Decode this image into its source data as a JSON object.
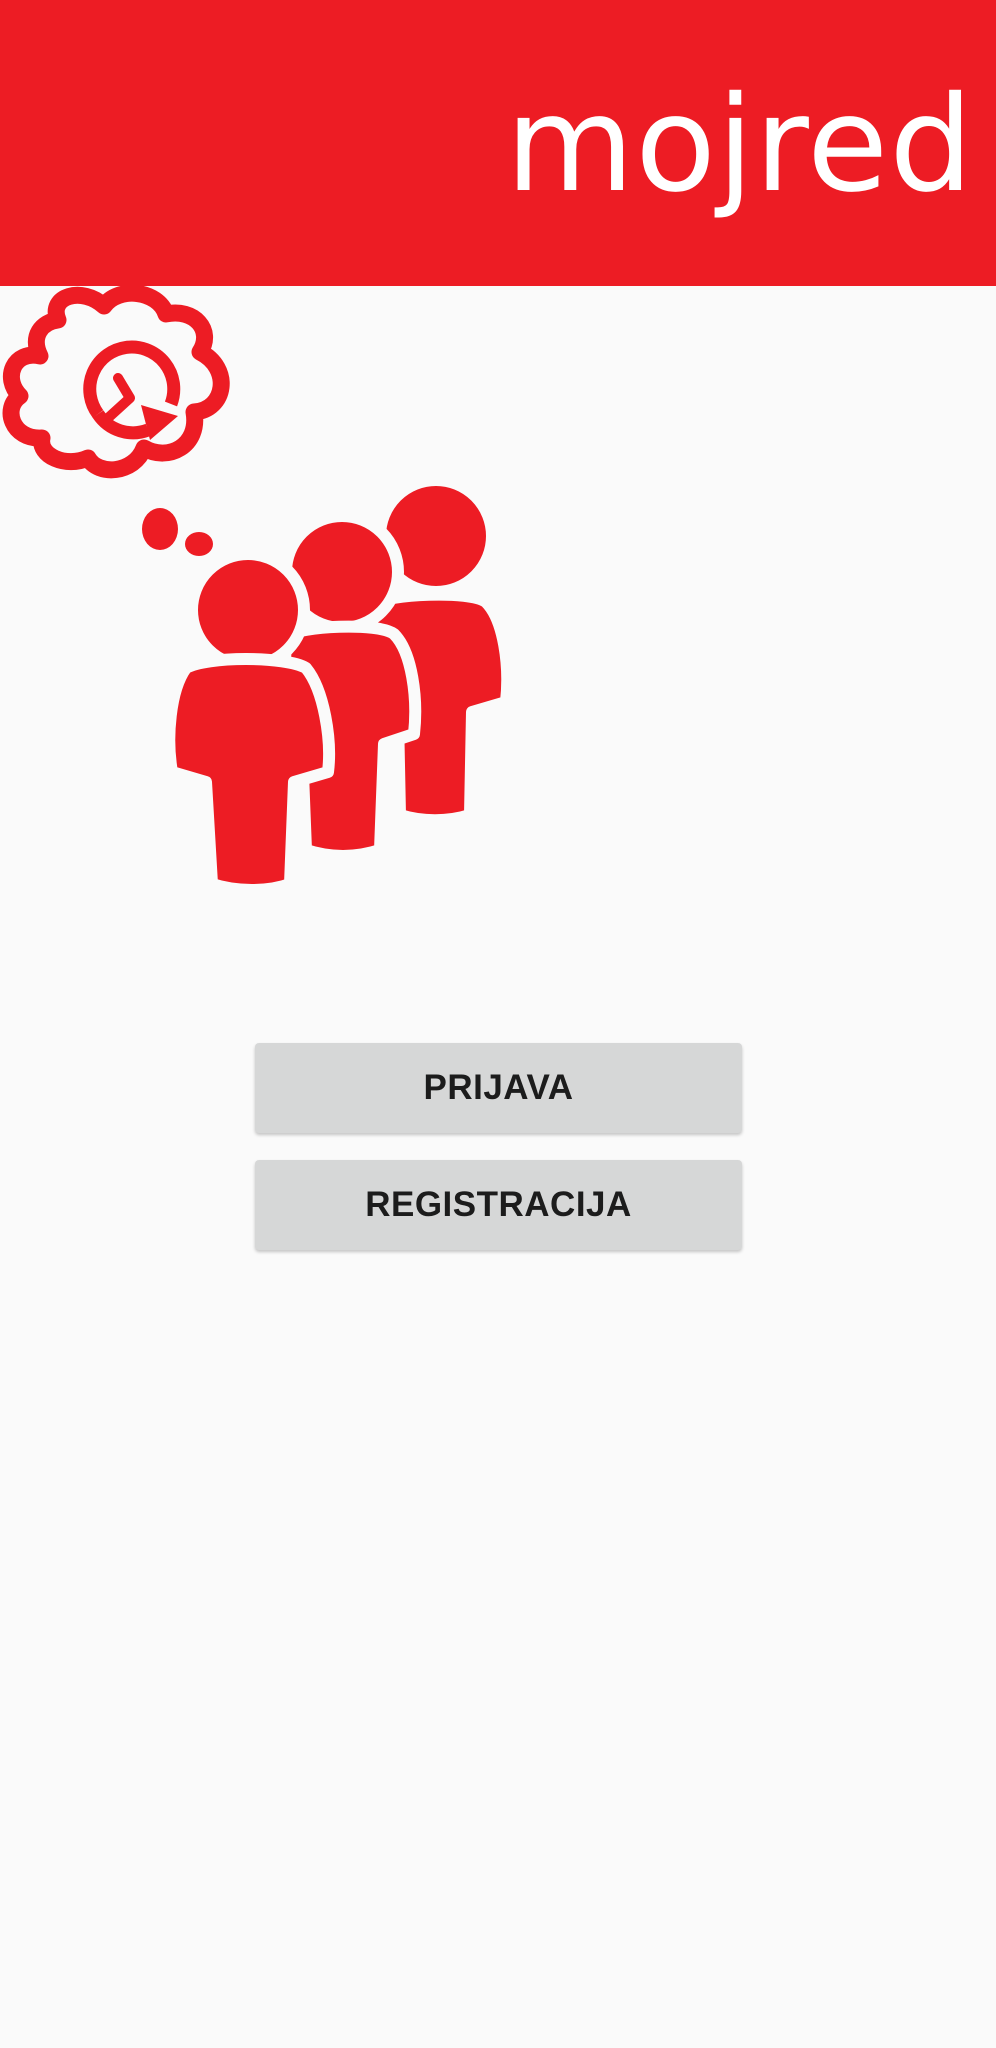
{
  "app": {
    "brand": "mojred",
    "brand_color": "#ed1c24",
    "background_color": "#fafafa",
    "logo_icon": "people-queue-thinking-clock"
  },
  "actions": {
    "login_label": "PRIJAVA",
    "register_label": "REGISTRACIJA"
  }
}
